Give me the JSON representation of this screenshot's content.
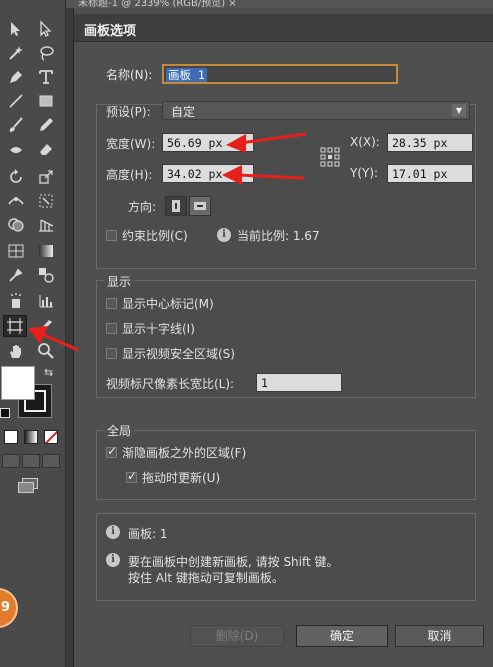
{
  "window": {
    "topbar_text": "未标题-1 @ 2339% (RGB/预览)  ×"
  },
  "toolbar": {
    "tools": [
      {
        "name": "selection-tool-icon"
      },
      {
        "name": "direct-selection-tool-icon"
      },
      {
        "name": "magic-wand-tool-icon"
      },
      {
        "name": "lasso-tool-icon"
      },
      {
        "name": "pen-tool-icon"
      },
      {
        "name": "type-tool-icon"
      },
      {
        "name": "line-tool-icon"
      },
      {
        "name": "rectangle-tool-icon"
      },
      {
        "name": "paintbrush-tool-icon"
      },
      {
        "name": "pencil-tool-icon"
      },
      {
        "name": "blob-brush-tool-icon"
      },
      {
        "name": "eraser-tool-icon"
      },
      {
        "name": "rotate-tool-icon"
      },
      {
        "name": "scale-tool-icon"
      },
      {
        "name": "width-tool-icon"
      },
      {
        "name": "free-transform-tool-icon"
      },
      {
        "name": "shape-builder-tool-icon"
      },
      {
        "name": "perspective-grid-tool-icon"
      },
      {
        "name": "mesh-tool-icon"
      },
      {
        "name": "gradient-tool-icon"
      },
      {
        "name": "eyedropper-tool-icon"
      },
      {
        "name": "blend-tool-icon"
      },
      {
        "name": "symbol-sprayer-tool-icon"
      },
      {
        "name": "column-graph-tool-icon"
      },
      {
        "name": "artboard-tool-icon"
      },
      {
        "name": "slice-tool-icon"
      },
      {
        "name": "hand-tool-icon"
      },
      {
        "name": "zoom-tool-icon"
      }
    ],
    "badge_text": "9"
  },
  "dialog": {
    "title": "画板选项",
    "name_label": "名称(N):",
    "name_value": "画板 1",
    "preset_label": "预设(P):",
    "preset_value": "自定",
    "width_label": "宽度(W):",
    "width_value": "56.69 px",
    "height_label": "高度(H):",
    "height_value": "34.02 px",
    "x_label": "X(X):",
    "x_value": "28.35 px",
    "y_label": "Y(Y):",
    "y_value": "17.01 px",
    "orientation_label": "方向:",
    "constrain_label": "约束比例(C)",
    "constrain_checked": false,
    "ratio_text": "当前比例: 1.67",
    "display": {
      "title": "显示",
      "center_mark": "显示中心标记(M)",
      "cross_hairs": "显示十字线(I)",
      "video_safe": "显示视频安全区域(S)",
      "pixel_ratio_label": "视频标尺像素长宽比(L):",
      "pixel_ratio_value": "1"
    },
    "global": {
      "title": "全局",
      "fade_outside": "渐隐画板之外的区域(F)",
      "fade_checked": true,
      "update_while_drag": "拖动时更新(U)",
      "update_checked": true
    },
    "info": {
      "artboard_count": "画板: 1",
      "tip_line1": "要在画板中创建新画板, 请按 Shift 键。",
      "tip_line2": "按住 Alt 键拖动可复制画板。"
    },
    "buttons": {
      "delete": "删除(D)",
      "ok": "确定",
      "cancel": "取消"
    }
  },
  "colors": {
    "annotation_red": "#e8201c",
    "focus_orange": "#c58a3b"
  }
}
